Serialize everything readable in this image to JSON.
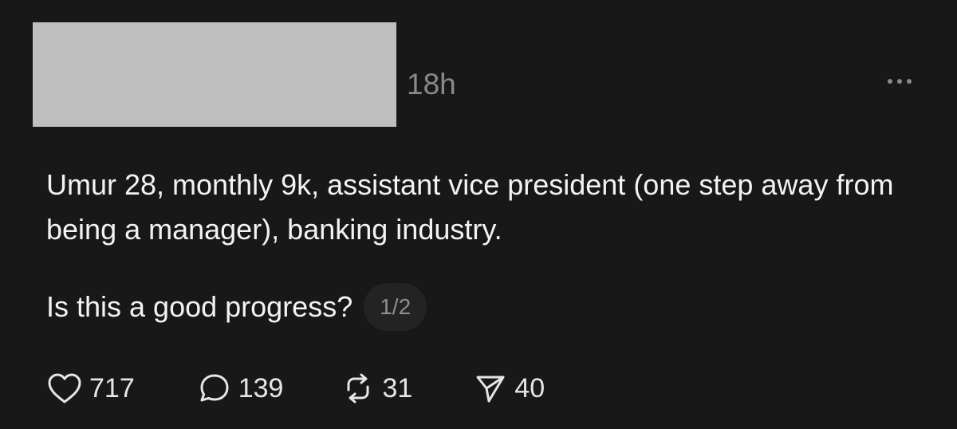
{
  "post": {
    "timestamp": "18h",
    "text": "Umur 28, monthly 9k, assistant vice president (one step away from being a manager), banking industry.",
    "question": "Is this a good progress?",
    "page_counter": "1/2"
  },
  "actions": {
    "likes": "717",
    "replies": "139",
    "reposts": "31",
    "shares": "40"
  },
  "icons": {
    "like": "heart-icon",
    "reply": "speech-bubble-icon",
    "repost": "repost-icon",
    "share": "send-icon",
    "more": "more-horizontal-icon"
  },
  "colors": {
    "background": "#181818",
    "text": "#f3f3f3",
    "muted": "#8a8a8a",
    "redaction": "#bfbfbf"
  }
}
